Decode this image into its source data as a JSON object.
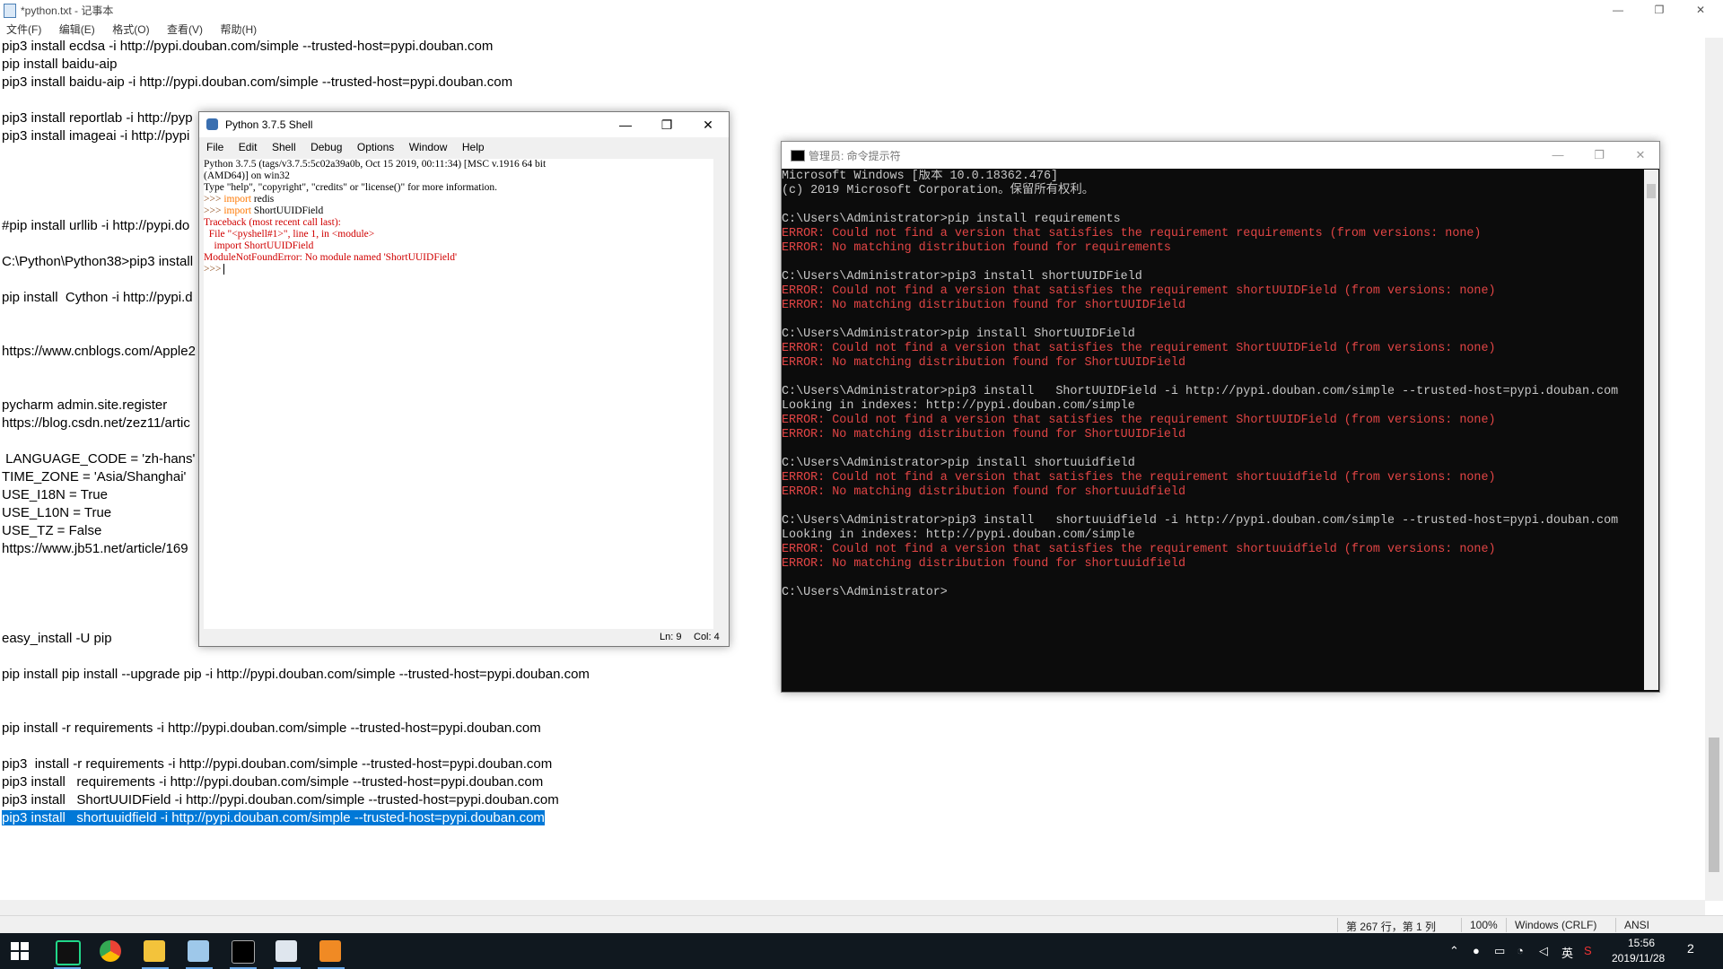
{
  "notepad": {
    "title": "*python.txt - 记事本",
    "window_buttons": {
      "minimize": "—",
      "maximize": "❐",
      "close": "✕"
    },
    "menus": [
      "文件(F)",
      "编辑(E)",
      "格式(O)",
      "查看(V)",
      "帮助(H)"
    ],
    "lines": [
      "pip3 install ecdsa -i http://pypi.douban.com/simple --trusted-host=pypi.douban.com",
      "pip install baidu-aip",
      "pip3 install baidu-aip -i http://pypi.douban.com/simple --trusted-host=pypi.douban.com",
      "",
      "pip3 install reportlab -i http://pyp",
      "pip3 install imageai -i http://pypi",
      "",
      "",
      "",
      "",
      "#pip install urllib -i http://pypi.do",
      "",
      "C:\\Python\\Python38>pip3 install",
      "",
      "pip install  Cython -i http://pypi.d",
      "",
      "",
      "https://www.cnblogs.com/Apple2",
      "",
      "",
      "pycharm admin.site.register",
      "https://blog.csdn.net/zez11/artic",
      "",
      " LANGUAGE_CODE = 'zh-hans'",
      "TIME_ZONE = 'Asia/Shanghai'",
      "USE_I18N = True",
      "USE_L10N = True",
      "USE_TZ = False",
      "https://www.jb51.net/article/169",
      "",
      "",
      "",
      "",
      "easy_install -U pip",
      "",
      "pip install pip install --upgrade pip -i http://pypi.douban.com/simple --trusted-host=pypi.douban.com",
      "",
      "",
      "pip install -r requirements -i http://pypi.douban.com/simple --trusted-host=pypi.douban.com",
      "",
      "pip3  install -r requirements -i http://pypi.douban.com/simple --trusted-host=pypi.douban.com",
      "pip3 install   requirements -i http://pypi.douban.com/simple --trusted-host=pypi.douban.com",
      "pip3 install   ShortUUIDField -i http://pypi.douban.com/simple --trusted-host=pypi.douban.com",
      "pip3 install   shortuuidfield -i http://pypi.douban.com/simple --trusted-host=pypi.douban.com"
    ],
    "selected_line_index": 43,
    "status": {
      "position": "第 267 行，第 1 列",
      "zoom": "100%",
      "line_ending": "Windows (CRLF)",
      "encoding": "ANSI"
    }
  },
  "idle": {
    "title": "Python 3.7.5 Shell",
    "menus": [
      "File",
      "Edit",
      "Shell",
      "Debug",
      "Options",
      "Window",
      "Help"
    ],
    "banner1": "Python 3.7.5 (tags/v3.7.5:5c02a39a0b, Oct 15 2019, 00:11:34) [MSC v.1916 64 bit",
    "banner2": "(AMD64)] on win32",
    "banner3": "Type \"help\", \"copyright\", \"credits\" or \"license()\" for more information.",
    "prompt": ">>> ",
    "kw_import": "import",
    "mod1": " redis",
    "mod2": " ShortUUIDField",
    "tb1": "Traceback (most recent call last):",
    "tb2": "  File \"<pyshell#1>\", line 1, in <module>",
    "tb3": "    import ShortUUIDField",
    "tb4": "ModuleNotFoundError: No module named 'ShortUUIDField'",
    "cursor_prompt": ">>> ",
    "status_ln": "Ln: 9",
    "status_col": "Col: 4"
  },
  "cmd": {
    "title": "管理员: 命令提示符",
    "lines": [
      {
        "t": "Microsoft Windows [版本 10.0.18362.476]",
        "e": false
      },
      {
        "t": "(c) 2019 Microsoft Corporation。保留所有权利。",
        "e": false
      },
      {
        "t": "",
        "e": false
      },
      {
        "t": "C:\\Users\\Administrator>pip install requirements",
        "e": false
      },
      {
        "t": "ERROR: Could not find a version that satisfies the requirement requirements (from versions: none)",
        "e": true
      },
      {
        "t": "ERROR: No matching distribution found for requirements",
        "e": true
      },
      {
        "t": "",
        "e": false
      },
      {
        "t": "C:\\Users\\Administrator>pip3 install shortUUIDField",
        "e": false
      },
      {
        "t": "ERROR: Could not find a version that satisfies the requirement shortUUIDField (from versions: none)",
        "e": true
      },
      {
        "t": "ERROR: No matching distribution found for shortUUIDField",
        "e": true
      },
      {
        "t": "",
        "e": false
      },
      {
        "t": "C:\\Users\\Administrator>pip install ShortUUIDField",
        "e": false
      },
      {
        "t": "ERROR: Could not find a version that satisfies the requirement ShortUUIDField (from versions: none)",
        "e": true
      },
      {
        "t": "ERROR: No matching distribution found for ShortUUIDField",
        "e": true
      },
      {
        "t": "",
        "e": false
      },
      {
        "t": "C:\\Users\\Administrator>pip3 install   ShortUUIDField -i http://pypi.douban.com/simple --trusted-host=pypi.douban.com",
        "e": false
      },
      {
        "t": "Looking in indexes: http://pypi.douban.com/simple",
        "e": false
      },
      {
        "t": "ERROR: Could not find a version that satisfies the requirement ShortUUIDField (from versions: none)",
        "e": true
      },
      {
        "t": "ERROR: No matching distribution found for ShortUUIDField",
        "e": true
      },
      {
        "t": "",
        "e": false
      },
      {
        "t": "C:\\Users\\Administrator>pip install shortuuidfield",
        "e": false
      },
      {
        "t": "ERROR: Could not find a version that satisfies the requirement shortuuidfield (from versions: none)",
        "e": true
      },
      {
        "t": "ERROR: No matching distribution found for shortuuidfield",
        "e": true
      },
      {
        "t": "",
        "e": false
      },
      {
        "t": "C:\\Users\\Administrator>pip3 install   shortuuidfield -i http://pypi.douban.com/simple --trusted-host=pypi.douban.com",
        "e": false
      },
      {
        "t": "Looking in indexes: http://pypi.douban.com/simple",
        "e": false
      },
      {
        "t": "ERROR: Could not find a version that satisfies the requirement shortuuidfield (from versions: none)",
        "e": true
      },
      {
        "t": "ERROR: No matching distribution found for shortuuidfield",
        "e": true
      },
      {
        "t": "",
        "e": false
      },
      {
        "t": "C:\\Users\\Administrator>",
        "e": false
      }
    ]
  },
  "taskbar": {
    "time": "15:56",
    "date": "2019/11/28",
    "ime": "英",
    "notifications": "2",
    "apps": [
      "start-icon",
      "pycharm-icon",
      "chrome-icon",
      "file-explorer-icon",
      "notepad-icon",
      "cmd-icon",
      "idle-icon",
      "video-icon"
    ]
  },
  "colors": {
    "selection": "#0078d7",
    "cmd_bg": "#0c0c0c",
    "cmd_error": "#e24545",
    "idle_error": "#d00000",
    "idle_keyword": "#ff7700",
    "taskbar": "#10181f"
  }
}
